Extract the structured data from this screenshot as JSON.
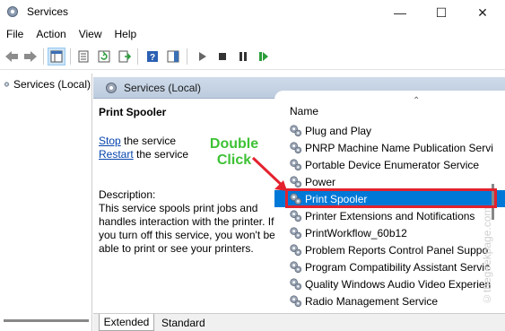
{
  "window": {
    "title": "Services",
    "controls": {
      "minimize": "—",
      "maximize": "☐",
      "close": "✕"
    }
  },
  "menu": [
    "File",
    "Action",
    "View",
    "Help"
  ],
  "toolbar": {
    "buttons": [
      "back-icon",
      "forward-icon",
      "show-tree-icon",
      "properties-icon",
      "refresh-icon",
      "export-icon",
      "help-icon",
      "show-pane-icon",
      "play-icon",
      "stop-icon",
      "pause-icon",
      "restart-icon"
    ]
  },
  "tree": {
    "item": "Services (Local)"
  },
  "header": {
    "title": "Services (Local)"
  },
  "description": {
    "service_name": "Print Spooler",
    "stop_link": "Stop",
    "stop_suffix": " the service",
    "restart_link": "Restart",
    "restart_suffix": " the service",
    "heading": "Description:",
    "body": "This service spools print jobs and handles interaction with the printer. If you turn off this service, you won't be able to print or see your printers."
  },
  "list": {
    "column_name": "Name",
    "rows": [
      "Plug and Play",
      "PNRP Machine Name Publication Servi",
      "Portable Device Enumerator Service",
      "Power",
      "Print Spooler",
      "Printer Extensions and Notifications",
      "PrintWorkflow_60b12",
      "Problem Reports Control Panel Suppo",
      "Program Compatibility Assistant Servic",
      "Quality Windows Audio Video Experien",
      "Radio Management Service"
    ],
    "selected_index": 4
  },
  "annotation": {
    "line1": "Double",
    "line2": "Click",
    "color": "#3ec235",
    "highlight_color": "#e3222e"
  },
  "watermark": "©thegeekpage.com",
  "tabs": {
    "extended": "Extended",
    "standard": "Standard"
  },
  "colors": {
    "selection": "#0078d7",
    "header_band": "#c6d4e7",
    "link": "#0645ad"
  }
}
